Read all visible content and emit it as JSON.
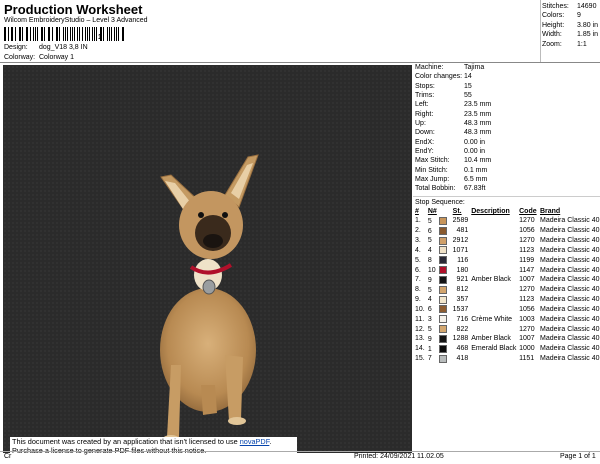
{
  "header": {
    "title": "Production Worksheet",
    "subtitle": "Wilcom EmbroideryStudio – Level 3 Advanced",
    "barcode_text": "1",
    "design_label": "Design:",
    "design_value": "dog_V18 3,8 IN",
    "colorway_label": "Colorway:",
    "colorway_value": "Colorway 1"
  },
  "summary": [
    {
      "label": "Stitches:",
      "value": "14690"
    },
    {
      "label": "Colors:",
      "value": "9"
    },
    {
      "label": "Height:",
      "value": "3.80 in"
    },
    {
      "label": "Width:",
      "value": "1.85 in"
    },
    {
      "label": "Zoom:",
      "value": "1:1"
    }
  ],
  "details": [
    {
      "label": "Machine:",
      "value": "Tajima"
    },
    {
      "label": "Color changes:",
      "value": "14"
    },
    {
      "label": "Stops:",
      "value": "15"
    },
    {
      "label": "Trims:",
      "value": "55"
    },
    {
      "label": "Left:",
      "value": "23.5 mm"
    },
    {
      "label": "Right:",
      "value": "23.5 mm"
    },
    {
      "label": "Up:",
      "value": "48.3 mm"
    },
    {
      "label": "Down:",
      "value": "48.3 mm"
    },
    {
      "label": "EndX:",
      "value": "0.00 in"
    },
    {
      "label": "EndY:",
      "value": "0.00 in"
    },
    {
      "label": "Max Stitch:",
      "value": "10.4 mm"
    },
    {
      "label": "Min Stitch:",
      "value": "0.1 mm"
    },
    {
      "label": "Max Jump:",
      "value": "6.5 mm"
    },
    {
      "label": "Total Bobbin:",
      "value": "67.83ft"
    }
  ],
  "stop_sequence": {
    "title": "Stop Sequence:",
    "columns": [
      "#",
      "N#",
      "St.",
      "Description",
      "Code",
      "Brand"
    ],
    "rows": [
      {
        "num": "1.",
        "n": "5",
        "color": "#c8955a",
        "st": "2589",
        "desc": "",
        "code": "1270",
        "brand": "Madeira Classic 40"
      },
      {
        "num": "2.",
        "n": "6",
        "color": "#8a5a2e",
        "st": "481",
        "desc": "",
        "code": "1056",
        "brand": "Madeira Classic 40"
      },
      {
        "num": "3.",
        "n": "5",
        "color": "#d0a06a",
        "st": "2912",
        "desc": "",
        "code": "1270",
        "brand": "Madeira Classic 40"
      },
      {
        "num": "4.",
        "n": "4",
        "color": "#f0e2c8",
        "st": "1071",
        "desc": "",
        "code": "1123",
        "brand": "Madeira Classic 40"
      },
      {
        "num": "5.",
        "n": "8",
        "color": "#2a2a36",
        "st": "116",
        "desc": "",
        "code": "1199",
        "brand": "Madeira Classic 40"
      },
      {
        "num": "6.",
        "n": "10",
        "color": "#b0102a",
        "st": "180",
        "desc": "",
        "code": "1147",
        "brand": "Madeira Classic 40"
      },
      {
        "num": "7.",
        "n": "9",
        "color": "#141414",
        "st": "921",
        "desc": "Amber Black",
        "code": "1007",
        "brand": "Madeira Classic 40"
      },
      {
        "num": "8.",
        "n": "5",
        "color": "#d2a46c",
        "st": "812",
        "desc": "",
        "code": "1270",
        "brand": "Madeira Classic 40"
      },
      {
        "num": "9.",
        "n": "4",
        "color": "#f2e6cc",
        "st": "357",
        "desc": "",
        "code": "1123",
        "brand": "Madeira Classic 40"
      },
      {
        "num": "10.",
        "n": "6",
        "color": "#8c5c30",
        "st": "1537",
        "desc": "",
        "code": "1056",
        "brand": "Madeira Classic 40"
      },
      {
        "num": "11.",
        "n": "3",
        "color": "#f6f2ea",
        "st": "716",
        "desc": "Crème White",
        "code": "1003",
        "brand": "Madeira Classic 40"
      },
      {
        "num": "12.",
        "n": "5",
        "color": "#d4a870",
        "st": "822",
        "desc": "",
        "code": "1270",
        "brand": "Madeira Classic 40"
      },
      {
        "num": "13.",
        "n": "9",
        "color": "#141414",
        "st": "1288",
        "desc": "Amber Black",
        "code": "1007",
        "brand": "Madeira Classic 40"
      },
      {
        "num": "14.",
        "n": "1",
        "color": "#0c0c0c",
        "st": "468",
        "desc": "Emerald Black",
        "code": "1000",
        "brand": "Madeira Classic 40"
      },
      {
        "num": "15.",
        "n": "7",
        "color": "#b8bcbc",
        "st": "418",
        "desc": "",
        "code": "1151",
        "brand": "Madeira Classic 40"
      }
    ]
  },
  "notice": {
    "line1_prefix": "This document was created by an application that isn't licensed to use ",
    "link": "novaPDF",
    "line1_suffix": ".",
    "line2": "Purchase a license to generate PDF files without this notice."
  },
  "footer": {
    "left": "Cr",
    "printed": "Printed: 24/09/2021 11.02.05",
    "page": "Page 1 of 1"
  }
}
